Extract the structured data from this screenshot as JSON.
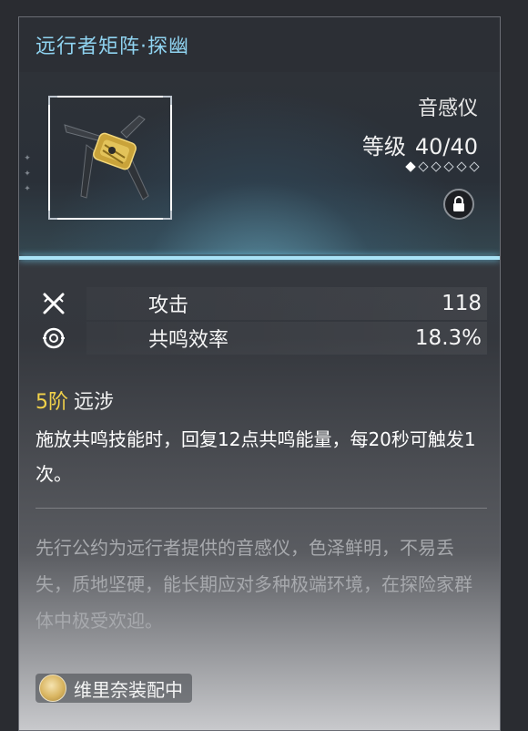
{
  "header": {
    "title": "远行者矩阵·探幽"
  },
  "item": {
    "type": "音感仪",
    "level_label": "等级",
    "level_value": "40/40",
    "rank_diamonds": {
      "filled": 1,
      "total": 6
    },
    "lock_icon": "lock-icon",
    "weapon_icon": "weapon-device-icon"
  },
  "stats": [
    {
      "icon": "attack-icon",
      "name": "攻击",
      "value": "118"
    },
    {
      "icon": "resonance-icon",
      "name": "共鸣效率",
      "value": "18.3%"
    }
  ],
  "passive": {
    "rank": "5阶",
    "name": "远涉",
    "description": "施放共鸣技能时，回复12点共鸣能量，每20秒可触发1次。"
  },
  "lore": "先行公约为远行者提供的音感仪，色泽鲜明，不易丢失，质地坚硬，能长期应对多种极端环境，在探险家群体中极受欢迎。",
  "equipped": {
    "avatar_icon": "character-avatar-icon",
    "label": "维里奈装配中"
  },
  "colors": {
    "title": "#8fd3f0",
    "rank": "#f2d24a",
    "accent_line": "#a9e3f7"
  }
}
